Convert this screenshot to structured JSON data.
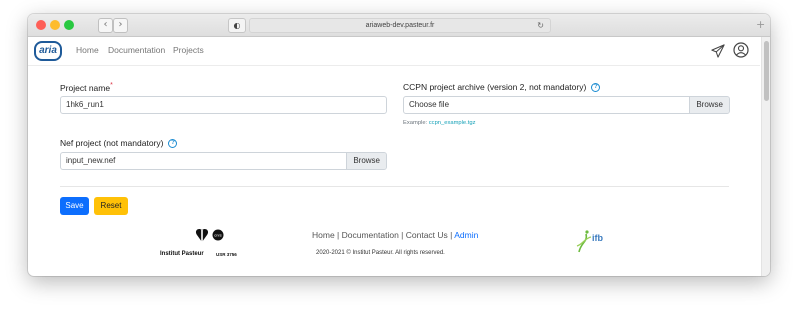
{
  "browser": {
    "url": "ariaweb-dev.pasteur.fr",
    "back_icon": "chevron-left-icon",
    "forward_icon": "chevron-right-icon",
    "back_glyph": "‹",
    "forward_glyph": "›",
    "reload_glyph": "↻",
    "newtab_glyph": "+",
    "shield_glyph": "◐",
    "lock_glyph": "🔒"
  },
  "navbar": {
    "logo": "aria",
    "links": [
      "Home",
      "Documentation",
      "Projects"
    ],
    "icons": [
      "paper-plane-icon",
      "user-circle-icon"
    ]
  },
  "form": {
    "project_name": {
      "label": "Project name",
      "required_mark": "*",
      "value": "1hk6_run1"
    },
    "ccpn_archive": {
      "label": "CCPN project archive (version 2, not mandatory)",
      "help_glyph": "?",
      "value": "Choose file",
      "browse_label": "Browse",
      "example_prefix": "Example: ",
      "example_link": "ccpn_example.tgz"
    },
    "nef_project": {
      "label": "Nef project (not mandatory)",
      "help_glyph": "?",
      "value": "input_new.nef",
      "browse_label": "Browse"
    },
    "save_label": "Save",
    "reset_label": "Reset"
  },
  "footer": {
    "links": {
      "home": "Home",
      "sep": " | ",
      "documentation": "Documentation",
      "contact": "Contact Us",
      "admin": "Admin"
    },
    "copyright": "2020-2021 © Institut Pasteur. All rights reserved.",
    "institut_pasteur": "Institut Pasteur",
    "usr": "USR 3756",
    "cnrs": "cnrs",
    "ifb": "ifb"
  },
  "colors": {
    "primary": "#0d6efd",
    "warning": "#ffc107",
    "logo": "#1e5a99",
    "link": "#17a2b8",
    "required": "#dc3545"
  }
}
